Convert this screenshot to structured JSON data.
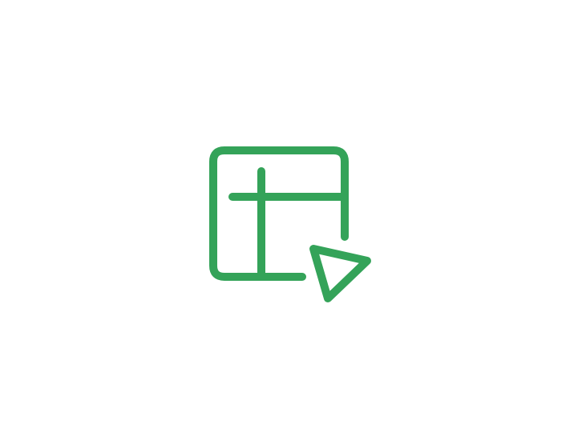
{
  "icon": {
    "name": "table-with-cursor-icon",
    "color": "#34A359"
  }
}
